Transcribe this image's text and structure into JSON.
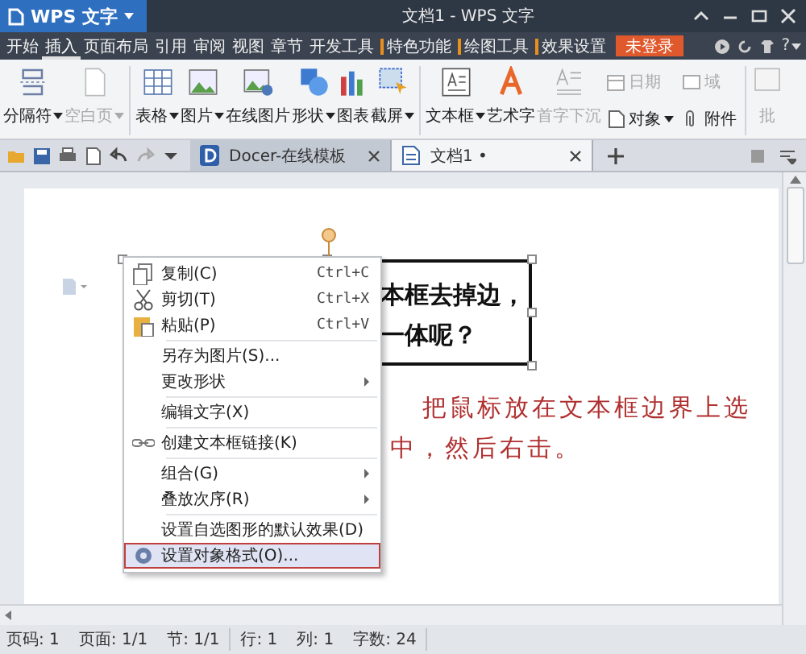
{
  "app_button": {
    "label": "WPS 文字",
    "dropdown": true
  },
  "window": {
    "title": "文档1 - WPS 文字"
  },
  "menu_tabs": [
    {
      "label": "开始",
      "selected": false,
      "marked": false
    },
    {
      "label": "插入",
      "selected": true,
      "marked": false
    },
    {
      "label": "页面布局",
      "selected": false,
      "marked": false
    },
    {
      "label": "引用",
      "selected": false,
      "marked": false
    },
    {
      "label": "审阅",
      "selected": false,
      "marked": false
    },
    {
      "label": "视图",
      "selected": false,
      "marked": false
    },
    {
      "label": "章节",
      "selected": false,
      "marked": false
    },
    {
      "label": "开发工具",
      "selected": false,
      "marked": false
    },
    {
      "label": "特色功能",
      "selected": false,
      "marked": true
    },
    {
      "label": "绘图工具",
      "selected": false,
      "marked": true
    },
    {
      "label": "效果设置",
      "selected": false,
      "marked": true
    }
  ],
  "login_badge": "未登录",
  "help_button": {
    "label": "?",
    "dropdown": true
  },
  "ribbon": [
    {
      "kind": "large",
      "label": "分隔符",
      "dropdown": true,
      "disabled": false
    },
    {
      "kind": "large",
      "label": "空白页",
      "dropdown": true,
      "disabled": true
    },
    {
      "kind": "divider"
    },
    {
      "kind": "large",
      "label": "表格",
      "dropdown": true,
      "disabled": false
    },
    {
      "kind": "large",
      "label": "图片",
      "dropdown": true,
      "disabled": false
    },
    {
      "kind": "large",
      "label": "在线图片",
      "dropdown": false,
      "disabled": false
    },
    {
      "kind": "large",
      "label": "形状",
      "dropdown": true,
      "disabled": false
    },
    {
      "kind": "large",
      "label": "图表",
      "dropdown": false,
      "disabled": false
    },
    {
      "kind": "large",
      "label": "截屏",
      "dropdown": true,
      "disabled": false
    },
    {
      "kind": "divider"
    },
    {
      "kind": "large",
      "label": "文本框",
      "dropdown": true,
      "disabled": false
    },
    {
      "kind": "large",
      "label": "艺术字",
      "dropdown": false,
      "disabled": false
    },
    {
      "kind": "large",
      "label": "首字下沉",
      "dropdown": false,
      "disabled": true
    },
    {
      "kind": "small",
      "items": [
        {
          "label": "日期",
          "dropdown": false,
          "disabled": true
        },
        {
          "label": "对象",
          "dropdown": true,
          "disabled": false
        }
      ]
    },
    {
      "kind": "small",
      "items": [
        {
          "label": "域",
          "dropdown": false,
          "disabled": true
        },
        {
          "label": "附件",
          "dropdown": false,
          "disabled": false
        }
      ]
    },
    {
      "kind": "divider"
    },
    {
      "kind": "large",
      "label": "批",
      "dropdown": false,
      "disabled": true
    }
  ],
  "doc_tabs": [
    {
      "label": "Docer-在线模板",
      "selected": false
    },
    {
      "label": "文档1",
      "mark": "•",
      "selected": true
    }
  ],
  "textbox": {
    "lines": [
      "本框去掉边，",
      "一体呢？"
    ]
  },
  "note": "把鼠标放在文本框边界上选中，然后右击。",
  "context_menu": [
    {
      "label": "复制(C)",
      "shortcut": "Ctrl+C",
      "submenu": false,
      "separator_before": false,
      "selected": false
    },
    {
      "label": "剪切(T)",
      "shortcut": "Ctrl+X",
      "submenu": false,
      "separator_before": false,
      "selected": false
    },
    {
      "label": "粘贴(P)",
      "shortcut": "Ctrl+V",
      "submenu": false,
      "separator_before": false,
      "selected": false
    },
    {
      "label": "另存为图片(S)...",
      "submenu": false,
      "separator_before": true,
      "selected": false
    },
    {
      "label": "更改形状",
      "submenu": true,
      "separator_before": false,
      "selected": false
    },
    {
      "label": "编辑文字(X)",
      "submenu": false,
      "separator_before": true,
      "selected": false
    },
    {
      "label": "创建文本框链接(K)",
      "submenu": false,
      "separator_before": true,
      "selected": false
    },
    {
      "label": "组合(G)",
      "submenu": true,
      "separator_before": true,
      "selected": false
    },
    {
      "label": "叠放次序(R)",
      "submenu": true,
      "separator_before": false,
      "selected": false
    },
    {
      "label": "设置自选图形的默认效果(D)",
      "submenu": false,
      "separator_before": true,
      "selected": false
    },
    {
      "label": "设置对象格式(O)...",
      "submenu": false,
      "separator_before": false,
      "selected": true
    }
  ],
  "status_bar": [
    "页码: 1",
    "页面: 1/1",
    "节: 1/1",
    "行: 1",
    "列: 1",
    "字数: 24"
  ]
}
